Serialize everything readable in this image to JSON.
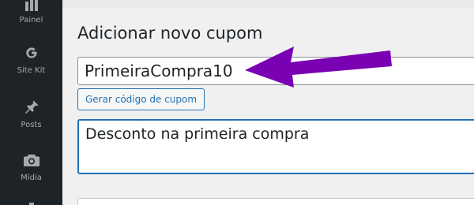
{
  "sidebar": {
    "items": [
      {
        "label": "Painel",
        "icon": "dashboard-bar-chart-icon"
      },
      {
        "label": "Site Kit",
        "icon": "google-g-icon"
      },
      {
        "label": "Posts",
        "icon": "pushpin-icon"
      },
      {
        "label": "Mídia",
        "icon": "camera-icon"
      }
    ]
  },
  "main": {
    "heading": "Adicionar novo cupom",
    "coupon_code": {
      "value": "PrimeiraCompra10"
    },
    "generate_button": {
      "label": "Gerar código de cupom"
    },
    "description": {
      "value": "Desconto na primeira compra"
    }
  },
  "annotation": {
    "arrow_color": "#7a00b3"
  },
  "colors": {
    "sidebar_bg": "#1d2327",
    "sidebar_icon": "#a7aaad",
    "accent": "#2271b1",
    "page_bg": "#f0f0f1"
  }
}
